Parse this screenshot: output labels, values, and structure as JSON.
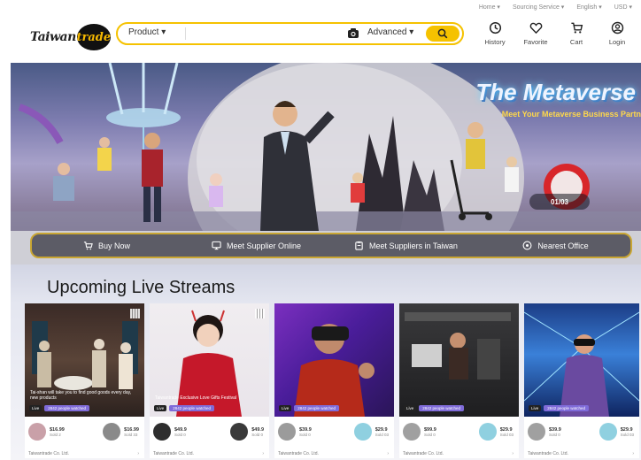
{
  "utility_bar": [
    "Home ▾",
    "Sourcing Service ▾",
    "English ▾",
    "USD ▾"
  ],
  "logo": {
    "part1": "Taiwan",
    "part2": "trade"
  },
  "search": {
    "category": "Product",
    "advanced": "Advanced"
  },
  "nav": [
    {
      "label": "History",
      "icon": "clock-icon"
    },
    {
      "label": "Favorite",
      "icon": "heart-icon"
    },
    {
      "label": "Cart",
      "icon": "cart-icon"
    },
    {
      "label": "Login",
      "icon": "user-icon"
    }
  ],
  "banner": {
    "title": "The Metaverse",
    "subtitle": "Meet Your Metaverse Business Partn",
    "pager": "01/03"
  },
  "quick_links": [
    {
      "label": "Buy Now",
      "icon": "cart-icon"
    },
    {
      "label": "Meet Supplier Online",
      "icon": "monitor-icon"
    },
    {
      "label": "Meet Suppliers in Taiwan",
      "icon": "clipboard-icon"
    },
    {
      "label": "Nearest Office",
      "icon": "location-pin-icon"
    }
  ],
  "live_streams": {
    "title": "Upcoming Live Streams",
    "cards": [
      {
        "caption": "Tai-shan will take you to find good goods every day, new products",
        "live": "Live",
        "count": "2842 people watched",
        "products": [
          {
            "price": "$16.99",
            "sold": "Sold 2"
          },
          {
            "price": "$16.99",
            "sold": "Sold 33"
          }
        ],
        "company": "Taiwantrade Co. Ltd."
      },
      {
        "caption": "Taiwantrade Exclusive Love Gifts Festival",
        "live": "Live",
        "count": "2842 people watched",
        "products": [
          {
            "price": "$49.9",
            "sold": "Sold 0"
          },
          {
            "price": "$49.9",
            "sold": "Sold 0"
          }
        ],
        "company": "Taiwantrade Co. Ltd."
      },
      {
        "caption": "",
        "live": "Live",
        "count": "2842 people watched",
        "products": [
          {
            "price": "$39.9",
            "sold": "Sold 0"
          },
          {
            "price": "$29.9",
            "sold": "Sold 03"
          }
        ],
        "company": "Taiwantrade Co. Ltd."
      },
      {
        "caption": "",
        "live": "Live",
        "count": "2842 people watched",
        "products": [
          {
            "price": "$99.9",
            "sold": "Sold 0"
          },
          {
            "price": "$29.9",
            "sold": "Sold 03"
          }
        ],
        "company": "Taiwantrade Co. Ltd."
      },
      {
        "caption": "",
        "live": "Live",
        "count": "2842 people watched",
        "products": [
          {
            "price": "$39.9",
            "sold": "Sold 0"
          },
          {
            "price": "$29.9",
            "sold": "Sold 03"
          }
        ],
        "company": "Taiwantrade Co. Ltd."
      }
    ]
  },
  "colors": {
    "accent": "#f5c200",
    "quicklinks_bg": "#5c5c66",
    "badge": "#7f6bd9"
  }
}
